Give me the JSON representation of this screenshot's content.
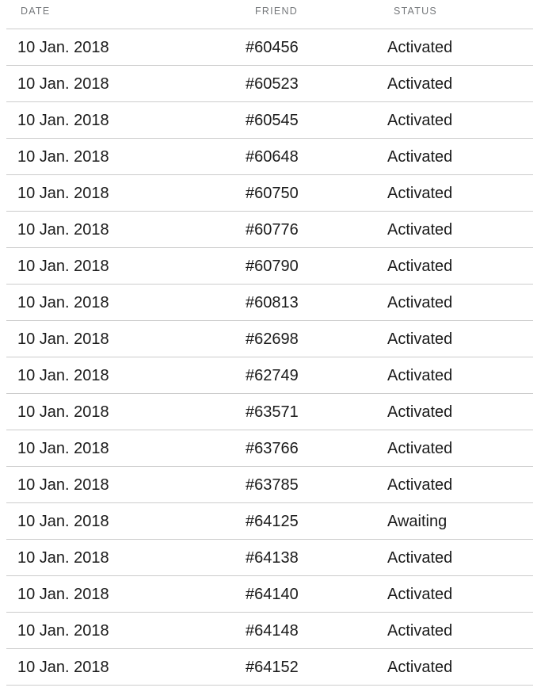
{
  "table": {
    "name": "referral-history-table",
    "columns": [
      {
        "key": "date",
        "label": "DATE"
      },
      {
        "key": "friend",
        "label": "FRIEND"
      },
      {
        "key": "status",
        "label": "STATUS"
      }
    ],
    "row_count": 18,
    "rows": [
      {
        "date": "10 Jan. 2018",
        "friend": "#60456",
        "status": "Activated"
      },
      {
        "date": "10 Jan. 2018",
        "friend": "#60523",
        "status": "Activated"
      },
      {
        "date": "10 Jan. 2018",
        "friend": "#60545",
        "status": "Activated"
      },
      {
        "date": "10 Jan. 2018",
        "friend": "#60648",
        "status": "Activated"
      },
      {
        "date": "10 Jan. 2018",
        "friend": "#60750",
        "status": "Activated"
      },
      {
        "date": "10 Jan. 2018",
        "friend": "#60776",
        "status": "Activated"
      },
      {
        "date": "10 Jan. 2018",
        "friend": "#60790",
        "status": "Activated"
      },
      {
        "date": "10 Jan. 2018",
        "friend": "#60813",
        "status": "Activated"
      },
      {
        "date": "10 Jan. 2018",
        "friend": "#62698",
        "status": "Activated"
      },
      {
        "date": "10 Jan. 2018",
        "friend": "#62749",
        "status": "Activated"
      },
      {
        "date": "10 Jan. 2018",
        "friend": "#63571",
        "status": "Activated"
      },
      {
        "date": "10 Jan. 2018",
        "friend": "#63766",
        "status": "Activated"
      },
      {
        "date": "10 Jan. 2018",
        "friend": "#63785",
        "status": "Activated"
      },
      {
        "date": "10 Jan. 2018",
        "friend": "#64125",
        "status": "Awaiting"
      },
      {
        "date": "10 Jan. 2018",
        "friend": "#64138",
        "status": "Activated"
      },
      {
        "date": "10 Jan. 2018",
        "friend": "#64140",
        "status": "Activated"
      },
      {
        "date": "10 Jan. 2018",
        "friend": "#64148",
        "status": "Activated"
      },
      {
        "date": "10 Jan. 2018",
        "friend": "#64152",
        "status": "Activated"
      }
    ]
  },
  "colors": {
    "page_background": "#ffffff",
    "header_text": "#76797c",
    "row_text": "#1b1b1b",
    "row_divider": "#cccccc"
  }
}
